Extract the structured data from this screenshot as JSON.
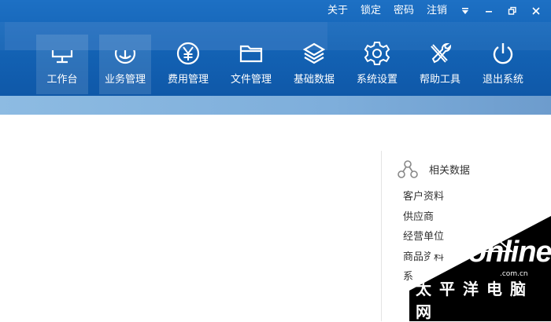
{
  "top_links": {
    "about": "关于",
    "lock": "锁定",
    "password": "密码",
    "logout": "注销"
  },
  "nav": [
    {
      "label": "工作台",
      "icon": "workbench-icon",
      "active": true
    },
    {
      "label": "业务管理",
      "icon": "business-icon",
      "active": true
    },
    {
      "label": "费用管理",
      "icon": "yen-icon"
    },
    {
      "label": "文件管理",
      "icon": "folder-icon"
    },
    {
      "label": "基础数据",
      "icon": "layers-icon"
    },
    {
      "label": "系统设置",
      "icon": "gear-icon"
    },
    {
      "label": "帮助工具",
      "icon": "tools-icon"
    },
    {
      "label": "退出系统",
      "icon": "power-icon"
    }
  ],
  "panel": {
    "title": "相关数据",
    "items": [
      "客户资料",
      "供应商",
      "经营单位",
      "商品资料",
      "系"
    ]
  },
  "watermark": {
    "brand": "PConline",
    "domain": ".com.cn",
    "cn": "太平洋电脑网"
  },
  "colors": {
    "header": "#1464b6",
    "subbar": "#8dbbe2",
    "accent": "#ffffff"
  }
}
